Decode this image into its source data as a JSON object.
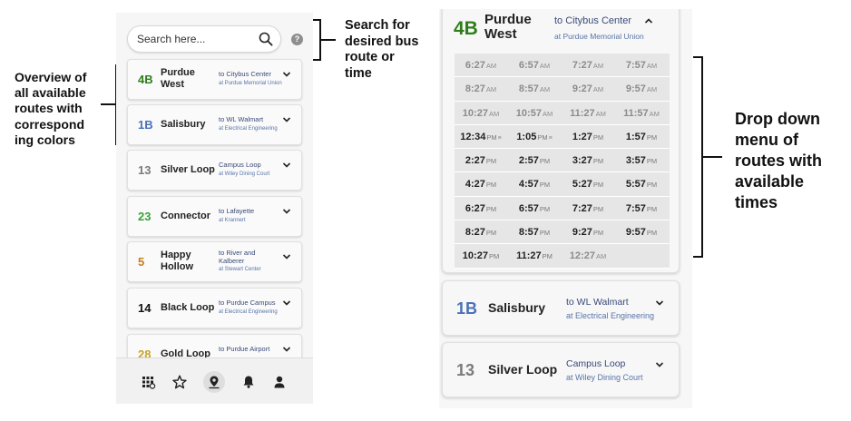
{
  "annotations": {
    "search": "Search for\ndesired bus\nroute or\ntime",
    "overview": "Overview of\nall available\nroutes with\ncorrespond\ning colors",
    "dropdown": "Drop down\nmenu of\nroutes with\navailable\ntimes"
  },
  "search": {
    "placeholder": "Search here...",
    "help_label": "?"
  },
  "routes": [
    {
      "number": "4B",
      "name": "Purdue West",
      "dest": "to Citybus Center",
      "at": "at Purdue Memorial Union",
      "color": "#2e7d1b"
    },
    {
      "number": "1B",
      "name": "Salisbury",
      "dest": "to WL Walmart",
      "at": "at Electrical Engineering",
      "color": "#4a72b8"
    },
    {
      "number": "13",
      "name": "Silver Loop",
      "dest": "Campus Loop",
      "at": "at Wiley Dining Court",
      "color": "#7b7b7b"
    },
    {
      "number": "23",
      "name": "Connector",
      "dest": "to Lafayette",
      "at": "at Krannert",
      "color": "#3aa23a"
    },
    {
      "number": "5",
      "name": "Happy Hollow",
      "dest": "to River and Kalberer",
      "at": "at Stewart Center",
      "color": "#c67d1a"
    },
    {
      "number": "14",
      "name": "Black Loop",
      "dest": "to Purdue Campus",
      "at": "at Electrical Engineering",
      "color": "#111111"
    },
    {
      "number": "28",
      "name": "Gold Loop",
      "dest": "to Purdue Airport",
      "at": "",
      "color": "#c9a227"
    }
  ],
  "nav": [
    "apps-icon",
    "favorites-star-icon",
    "map-pin-icon",
    "notifications-bell-icon",
    "profile-icon"
  ],
  "expanded": {
    "number": "4B",
    "name": "Purdue West",
    "dest": "to Citybus Center",
    "at": "at Purdue Memorial Union",
    "color": "#2e7d1b",
    "times": [
      [
        {
          "t": "6:27",
          "p": "AM"
        },
        {
          "t": "6:57",
          "p": "AM"
        },
        {
          "t": "7:27",
          "p": "AM"
        },
        {
          "t": "7:57",
          "p": "AM"
        }
      ],
      [
        {
          "t": "8:27",
          "p": "AM"
        },
        {
          "t": "8:57",
          "p": "AM"
        },
        {
          "t": "9:27",
          "p": "AM"
        },
        {
          "t": "9:57",
          "p": "AM"
        }
      ],
      [
        {
          "t": "10:27",
          "p": "AM"
        },
        {
          "t": "10:57",
          "p": "AM"
        },
        {
          "t": "11:27",
          "p": "AM"
        },
        {
          "t": "11:57",
          "p": "AM"
        }
      ],
      [
        {
          "t": "12:34",
          "p": "PM",
          "live": true
        },
        {
          "t": "1:05",
          "p": "PM",
          "live": true
        },
        {
          "t": "1:27",
          "p": "PM"
        },
        {
          "t": "1:57",
          "p": "PM"
        }
      ],
      [
        {
          "t": "2:27",
          "p": "PM"
        },
        {
          "t": "2:57",
          "p": "PM"
        },
        {
          "t": "3:27",
          "p": "PM"
        },
        {
          "t": "3:57",
          "p": "PM"
        }
      ],
      [
        {
          "t": "4:27",
          "p": "PM"
        },
        {
          "t": "4:57",
          "p": "PM"
        },
        {
          "t": "5:27",
          "p": "PM"
        },
        {
          "t": "5:57",
          "p": "PM"
        }
      ],
      [
        {
          "t": "6:27",
          "p": "PM"
        },
        {
          "t": "6:57",
          "p": "PM"
        },
        {
          "t": "7:27",
          "p": "PM"
        },
        {
          "t": "7:57",
          "p": "PM"
        }
      ],
      [
        {
          "t": "8:27",
          "p": "PM"
        },
        {
          "t": "8:57",
          "p": "PM"
        },
        {
          "t": "9:27",
          "p": "PM"
        },
        {
          "t": "9:57",
          "p": "PM"
        }
      ],
      [
        {
          "t": "10:27",
          "p": "PM"
        },
        {
          "t": "11:27",
          "p": "PM"
        },
        {
          "t": "12:27",
          "p": "AM"
        }
      ]
    ]
  }
}
